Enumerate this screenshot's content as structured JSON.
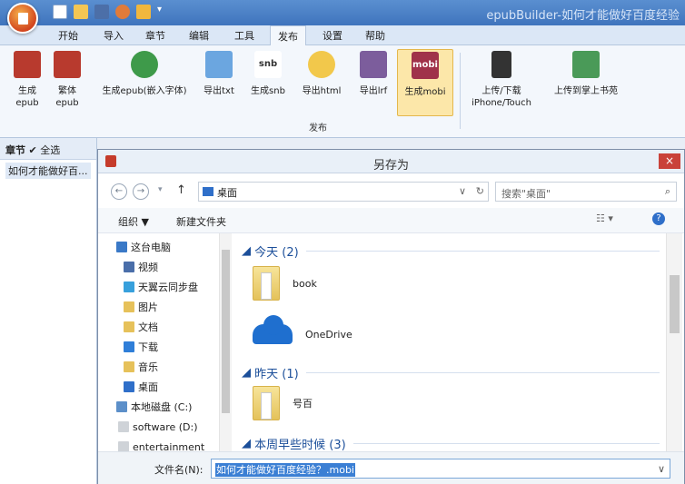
{
  "app": {
    "title": "epubBuilder-如何才能做好百度经验"
  },
  "tabs": [
    "开始",
    "导入",
    "章节",
    "编辑",
    "工具",
    "发布",
    "设置",
    "帮助"
  ],
  "active_tab": "发布",
  "ribbon": {
    "buttons": [
      {
        "label1": "生成",
        "label2": "epub"
      },
      {
        "label1": "繁体",
        "label2": "epub"
      },
      {
        "label1": "生成epub(嵌入字体)",
        "label2": ""
      },
      {
        "label1": "导出txt",
        "label2": ""
      },
      {
        "label1": "生成snb",
        "label2": ""
      },
      {
        "label1": "导出html",
        "label2": ""
      },
      {
        "label1": "导出lrf",
        "label2": ""
      },
      {
        "label1": "生成mobi",
        "label2": ""
      },
      {
        "label1": "上传/下载",
        "label2": "iPhone/Touch"
      },
      {
        "label1": "上传到掌上书苑",
        "label2": ""
      }
    ],
    "group_label": "发布",
    "snb_text": "snb",
    "mobi_text": "mobi"
  },
  "left_panel": {
    "header_label": "章节",
    "select_all": "全选",
    "item": "如何才能做好百..."
  },
  "dialog": {
    "title": "另存为",
    "close": "×",
    "address": "桌面",
    "search_placeholder": "搜索\"桌面\"",
    "organize": "组织 ▼",
    "new_folder": "新建文件夹",
    "tree": [
      "这台电脑",
      "视频",
      "天翼云同步盘",
      "图片",
      "文档",
      "下载",
      "音乐",
      "桌面",
      "本地磁盘 (C:)",
      "software (D:)",
      "entertainment"
    ],
    "groups": [
      {
        "label": "今天 (2)"
      },
      {
        "label": "昨天 (1)"
      },
      {
        "label": "本周早些时候 (3)"
      }
    ],
    "files": [
      {
        "name": "book"
      },
      {
        "name": "OneDrive"
      },
      {
        "name": "号百"
      }
    ],
    "filename_label": "文件名(N):",
    "filename_value": "如何才能做好百度经验？.mobi"
  },
  "colors": {
    "ribbon_active": "#fce7a9",
    "title_blue": "#3f74bd",
    "close_red": "#c9423a"
  }
}
